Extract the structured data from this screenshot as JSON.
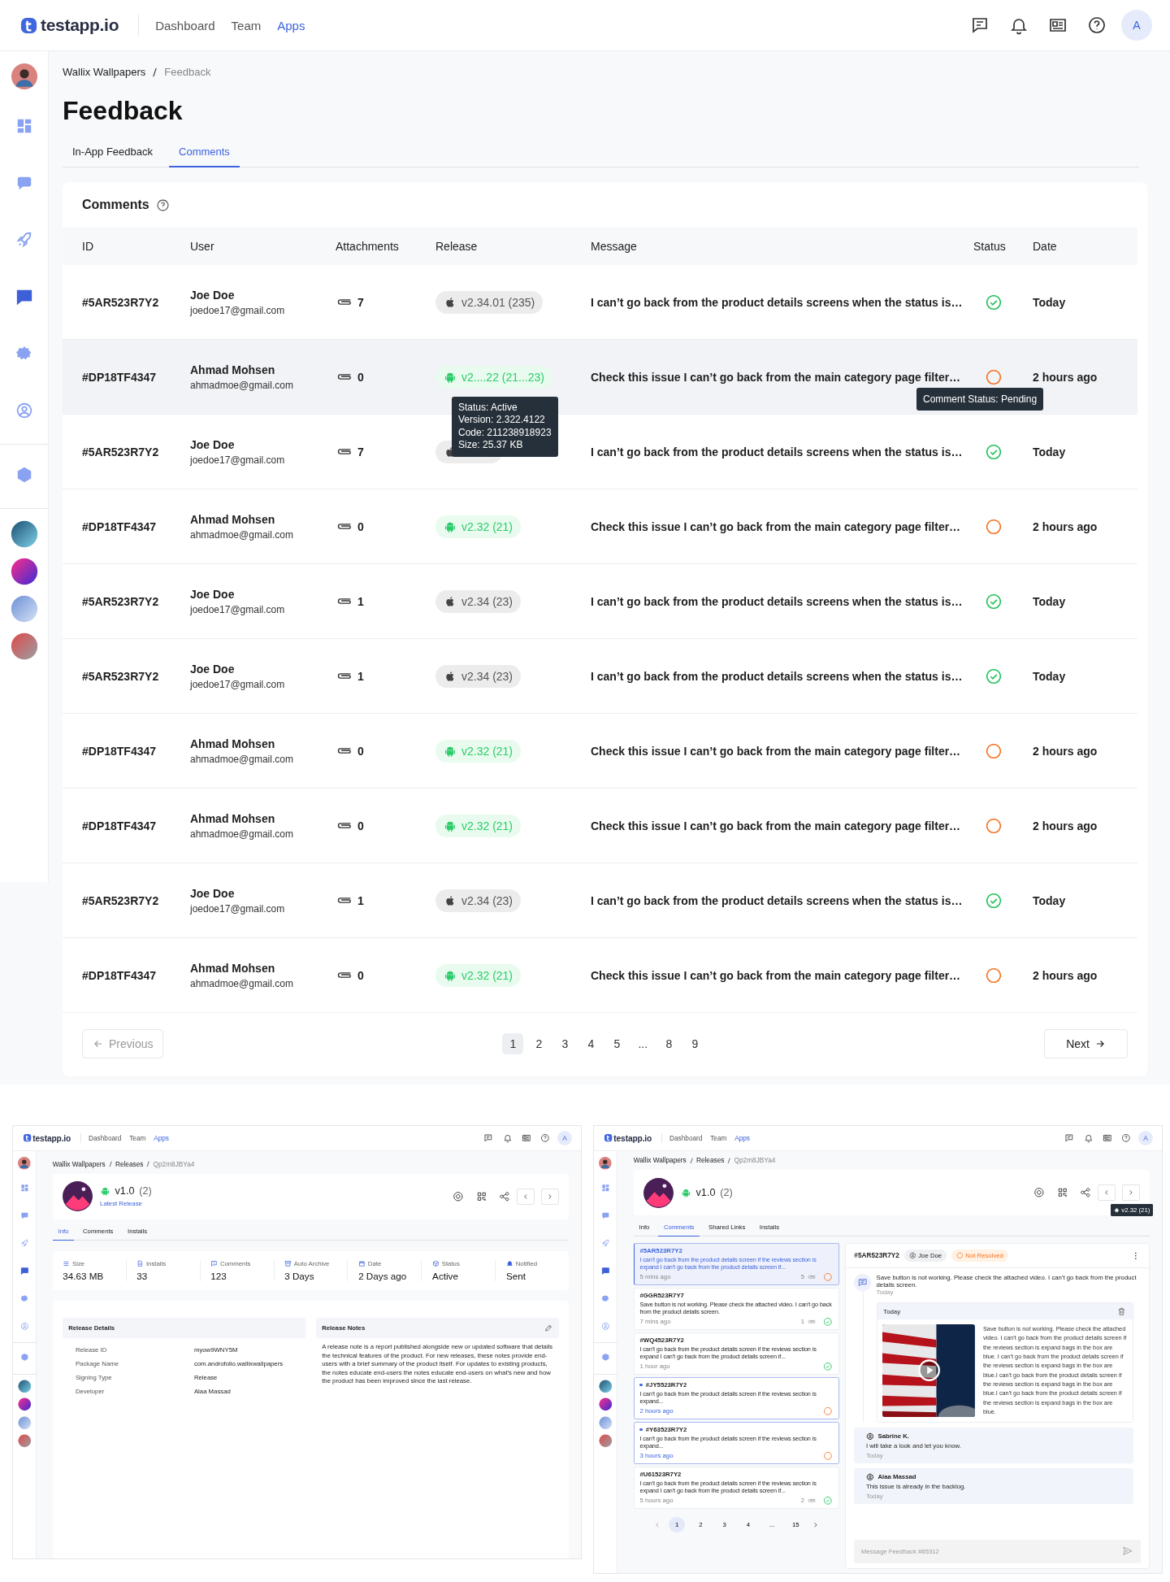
{
  "app": {
    "kind": "comments_table",
    "header": {
      "logo": "testapp.io",
      "nav": [
        {
          "label": "Dashboard",
          "selected": false
        },
        {
          "label": "Team",
          "selected": false
        },
        {
          "label": "Apps",
          "selected": true
        }
      ],
      "avatar": "A"
    },
    "sidebar": [
      {
        "selected": false
      },
      {
        "selected": false
      },
      {
        "selected": false
      },
      {
        "selected": true
      },
      {
        "selected": false
      },
      {
        "selected": false
      },
      {
        "selected": false
      }
    ],
    "breadcrumb": [
      "Wallix Wallpapers",
      "Feedback"
    ],
    "title": "Feedback",
    "tabs": [
      {
        "label": "In-App Feedback",
        "selected": false
      },
      {
        "label": "Comments",
        "selected": true
      }
    ],
    "card_title": "Comments",
    "columns": [
      "ID",
      "User",
      "Attachments",
      "Release",
      "Message",
      "Status",
      "Date"
    ],
    "rows": [
      {
        "id": "#5AR523R7Y2",
        "user": "Joe Doe",
        "email": "joedoe17@gmail.com",
        "attachments": "7",
        "release": {
          "kind": "ios",
          "label": "v2.34.01 (235)"
        },
        "message": "I can’t go back from the product details screens when the status is…",
        "resolved": true,
        "date": "Today",
        "hovered": false
      },
      {
        "id": "#DP18TF4347",
        "user": "Ahmad Mohsen",
        "email": "ahmadmoe@gmail.com",
        "attachments": "0",
        "release": {
          "kind": "android",
          "label": "v2....22 (21...23)"
        },
        "release_tooltip": [
          "Status: Active",
          "Version: 2.322.4122",
          "Code: 211238918923",
          "Size: 25.37 KB"
        ],
        "message": "Check this issue I can’t go back from the main category page filter…",
        "resolved": false,
        "status_tooltip": "Comment Status: Pending",
        "date": "2 hours ago",
        "hovered": true
      },
      {
        "id": "#5AR523R7Y2",
        "user": "Joe Doe",
        "email": "joedoe17@gmail.com",
        "attachments": "7",
        "release": {
          "kind": "ios"
        },
        "message": "I can’t go back from the product details screens when the status is…",
        "resolved": true,
        "date": "Today",
        "hovered": false
      },
      {
        "id": "#DP18TF4347",
        "user": "Ahmad Mohsen",
        "email": "ahmadmoe@gmail.com",
        "attachments": "0",
        "release": {
          "kind": "android",
          "label": "v2.32 (21)"
        },
        "message": "Check this issue I can’t go back from the main category page filter…",
        "resolved": false,
        "date": "2 hours ago",
        "hovered": false
      },
      {
        "id": "#5AR523R7Y2",
        "user": "Joe Doe",
        "email": "joedoe17@gmail.com",
        "attachments": "1",
        "release": {
          "kind": "ios",
          "label": "v2.34 (23)"
        },
        "message": "I can’t go back from the product details screens when the status is…",
        "resolved": true,
        "date": "Today",
        "hovered": false
      },
      {
        "id": "#5AR523R7Y2",
        "user": "Joe Doe",
        "email": "joedoe17@gmail.com",
        "attachments": "1",
        "release": {
          "kind": "ios",
          "label": "v2.34 (23)"
        },
        "message": "I can’t go back from the product details screens when the status is…",
        "resolved": true,
        "date": "Today",
        "hovered": false
      },
      {
        "id": "#DP18TF4347",
        "user": "Ahmad Mohsen",
        "email": "ahmadmoe@gmail.com",
        "attachments": "0",
        "release": {
          "kind": "android",
          "label": "v2.32 (21)"
        },
        "message": "Check this issue I can’t go back from the main category page filter…",
        "resolved": false,
        "date": "2 hours ago",
        "hovered": false
      },
      {
        "id": "#DP18TF4347",
        "user": "Ahmad Mohsen",
        "email": "ahmadmoe@gmail.com",
        "attachments": "0",
        "release": {
          "kind": "android",
          "label": "v2.32 (21)"
        },
        "message": "Check this issue I can’t go back from the main category page filter…",
        "resolved": false,
        "date": "2 hours ago",
        "hovered": false
      },
      {
        "id": "#5AR523R7Y2",
        "user": "Joe Doe",
        "email": "joedoe17@gmail.com",
        "attachments": "1",
        "release": {
          "kind": "ios",
          "label": "v2.34 (23)"
        },
        "message": "I can’t go back from the product details screens when the status is…",
        "resolved": true,
        "date": "Today",
        "hovered": false
      },
      {
        "id": "#DP18TF4347",
        "user": "Ahmad Mohsen",
        "email": "ahmadmoe@gmail.com",
        "attachments": "0",
        "release": {
          "kind": "android",
          "label": "v2.32 (21)"
        },
        "message": "Check this issue I can’t go back from the main category page filter…",
        "resolved": false,
        "date": "2 hours ago",
        "hovered": false
      }
    ],
    "pagination": {
      "previous": "Previous",
      "previous_disabled": true,
      "pages": [
        {
          "label": "1",
          "selected": true
        },
        {
          "label": "2",
          "selected": false
        },
        {
          "label": "3",
          "selected": false
        },
        {
          "label": "4",
          "selected": false
        },
        {
          "label": "5",
          "selected": false
        },
        {
          "label": "...",
          "selected": false
        },
        {
          "label": "8",
          "selected": false
        },
        {
          "label": "9",
          "selected": false
        }
      ],
      "next": "Next"
    }
  },
  "previews": [
    {
      "kind": "release_info",
      "header": {
        "logo": "testapp.io",
        "nav": [
          {
            "label": "Dashboard",
            "selected": false
          },
          {
            "label": "Team",
            "selected": false
          },
          {
            "label": "Apps",
            "selected": true
          }
        ],
        "avatar": "A"
      },
      "sidebar": [
        {
          "selected": false
        },
        {
          "selected": false
        },
        {
          "selected": false
        },
        {
          "selected": true
        },
        {
          "selected": false
        },
        {
          "selected": false
        },
        {
          "selected": false
        }
      ],
      "breadcrumb": [
        "Wallix Wallpapers",
        "Releases",
        "Qp2m8JBYa4"
      ],
      "release": {
        "kind": "android",
        "version": "v1.0",
        "count": "(2)",
        "badge": "Latest Release"
      },
      "tabs": [
        {
          "label": "Info",
          "selected": true
        },
        {
          "label": "Comments",
          "selected": false
        },
        {
          "label": "Installs",
          "selected": false
        }
      ],
      "stats": [
        {
          "label": "Size",
          "value": "34.63 MB"
        },
        {
          "label": "Installs",
          "value": "33"
        },
        {
          "label": "Comments",
          "value": "123"
        },
        {
          "label": "Auto Archive",
          "value": "3 Days"
        },
        {
          "label": "Date",
          "value": "2 Days ago"
        },
        {
          "label": "Status",
          "value": "Active"
        },
        {
          "label": "Notified",
          "value": "Sent"
        }
      ],
      "details": {
        "title": "Release Details",
        "rows": [
          {
            "label": "Release ID",
            "value": "myow9WNY5M"
          },
          {
            "label": "Package Name",
            "value": "com.androfolio.wallixwallpapers"
          },
          {
            "label": "Signing Type",
            "value": "Release"
          },
          {
            "label": "Developer",
            "value": "Alaa Massad"
          }
        ]
      },
      "notes": {
        "title": "Release Notes",
        "text": "A release note is a report published alongside new or updated software that details the technical features of the product. For new releases, these notes provide end-users with a brief summary of the product itself. For updates to existing products, the notes educate end-users the notes educate end-users on what's new and how the product has been improved since the last release."
      }
    },
    {
      "kind": "release_comments",
      "header": {
        "logo": "testapp.io",
        "nav": [
          {
            "label": "Dashboard",
            "selected": false
          },
          {
            "label": "Team",
            "selected": false
          },
          {
            "label": "Apps",
            "selected": true
          }
        ],
        "avatar": "A"
      },
      "sidebar": [
        {
          "selected": false
        },
        {
          "selected": false
        },
        {
          "selected": false
        },
        {
          "selected": true
        },
        {
          "selected": false
        },
        {
          "selected": false
        },
        {
          "selected": false
        }
      ],
      "breadcrumb": [
        "Wallix Wallpapers",
        "Releases",
        "Qp2m8JBYa4"
      ],
      "release": {
        "kind": "android",
        "version": "v1.0",
        "count": "(2)"
      },
      "next_tooltip": {
        "kind": "android",
        "label": "v2.32 (21)"
      },
      "tabs": [
        {
          "label": "Info",
          "selected": false
        },
        {
          "label": "Comments",
          "selected": true
        },
        {
          "label": "Shared Links",
          "selected": false
        },
        {
          "label": "Installs",
          "selected": false
        }
      ],
      "comments": [
        {
          "id": "#5AR523R7Y2",
          "text": "I can't go back from the product details screen if the reviews section is expand I can't go back from the product details screen if...",
          "time": "5 mins ago",
          "attachments": "5",
          "resolved": false,
          "selected": true,
          "unread": false
        },
        {
          "id": "#GGR523R7Y7",
          "text": "Save button is not working. Please check the attached video. I can't go back from the product details screen.",
          "time": "7 mins ago",
          "attachments": "1",
          "resolved": true,
          "selected": false,
          "unread": false
        },
        {
          "id": "#WQ4523R7Y2",
          "text": "I can't go back from the product details screen if the reviews section is expand I can't go back from the product details screen if...",
          "time": "1 hour ago",
          "resolved": true,
          "selected": false,
          "unread": false
        },
        {
          "id": "#JY5523R7Y2",
          "text": "I can't go back from the product details screen if the reviews section is expand...",
          "time": "2 hours ago",
          "resolved": false,
          "selected": false,
          "unread": true
        },
        {
          "id": "#Y63523R7Y2",
          "text": "I can't go back from the product details screen if the reviews section is expand...",
          "time": "3 hours ago",
          "resolved": false,
          "selected": false,
          "unread": true
        },
        {
          "id": "#U61523R7Y2",
          "text": "I can't go back from the product details screen if the reviews section is expand I can't go back from the product details screen if...",
          "time": "5 hours ago",
          "attachments": "2",
          "resolved": true,
          "selected": false,
          "unread": false
        }
      ],
      "list_pages": [
        {
          "label": "1",
          "selected": true
        },
        {
          "label": "2",
          "selected": false
        },
        {
          "label": "3",
          "selected": false
        },
        {
          "label": "4",
          "selected": false
        },
        {
          "label": "...",
          "selected": false
        },
        {
          "label": "15",
          "selected": false
        }
      ],
      "detail": {
        "id": "#5AR523R7Y2",
        "user": "Joe Doe",
        "resolved": false,
        "status_label": "Not Resolved",
        "message": "Save button is not working. Please check the attached video. I can't go back from the product details screen.",
        "time": "Today",
        "attachment": {
          "date": "Today",
          "text": "Save button is not working. Please check the attached video. I can't go back from the product details screen if the reviews section is expand bags in the box are blue. I can't go back from the product details screen if the reviews section is expand bags in the box are blue.I can't go back from the product details screen if the reviews section is expand bags in the box are blue.I can't go back from the product details screen if the reviews section is expand bags in the box are blue."
        },
        "replies": [
          {
            "author": "Sabrine K.",
            "text": "I will take a look and let you know.",
            "time": "Today"
          },
          {
            "author": "Alaa Massad",
            "text": "This issue is already in the backlog.",
            "time": "Today"
          }
        ],
        "placeholder": "Message Feedback #65312"
      }
    }
  ]
}
